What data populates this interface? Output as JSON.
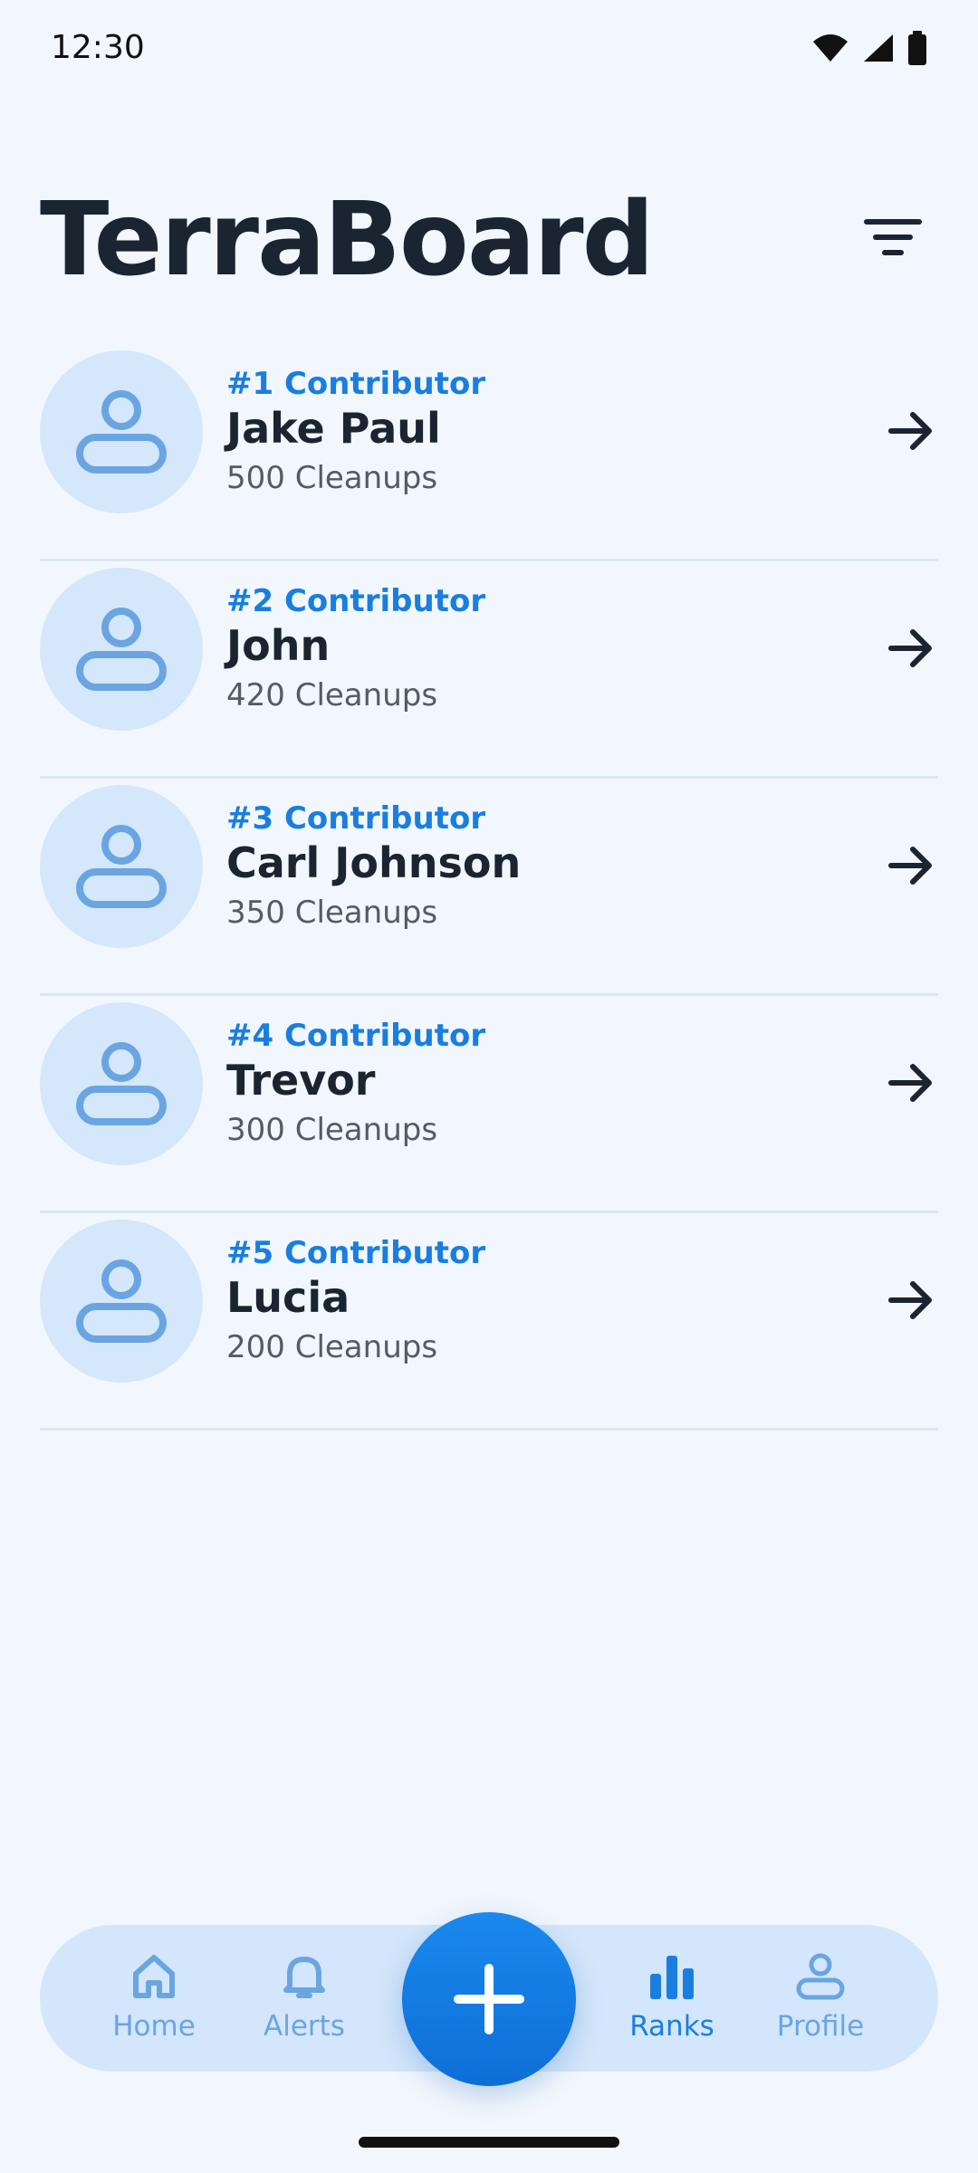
{
  "status_bar": {
    "time": "12:30",
    "icons": [
      "wifi-icon",
      "cell-signal-icon",
      "battery-icon"
    ]
  },
  "header": {
    "title": "TerraBoard",
    "filter_icon": "filter-icon"
  },
  "contributors": [
    {
      "rank": "#1 Contributor",
      "name": "Jake Paul",
      "cleanups": "500 Cleanups"
    },
    {
      "rank": "#2 Contributor",
      "name": "John",
      "cleanups": "420 Cleanups"
    },
    {
      "rank": "#3 Contributor",
      "name": "Carl Johnson",
      "cleanups": "350 Cleanups"
    },
    {
      "rank": "#4 Contributor",
      "name": "Trevor",
      "cleanups": "300 Cleanups"
    },
    {
      "rank": "#5 Contributor",
      "name": "Lucia",
      "cleanups": "200 Cleanups"
    }
  ],
  "bottom_nav": {
    "items": [
      {
        "label": "Home",
        "icon": "home-icon",
        "active": false
      },
      {
        "label": "Alerts",
        "icon": "bell-icon",
        "active": false
      },
      {
        "label": "Ranks",
        "icon": "bar-chart-icon",
        "active": true
      },
      {
        "label": "Profile",
        "icon": "person-icon",
        "active": false
      }
    ],
    "fab_icon": "plus-icon"
  },
  "colors": {
    "accent": "#1a7ee0",
    "background": "#f2f7fd",
    "avatar_bg": "#d4e7fb",
    "nav_bg": "#d3e6fb",
    "inactive_nav": "#6aa5e2"
  }
}
